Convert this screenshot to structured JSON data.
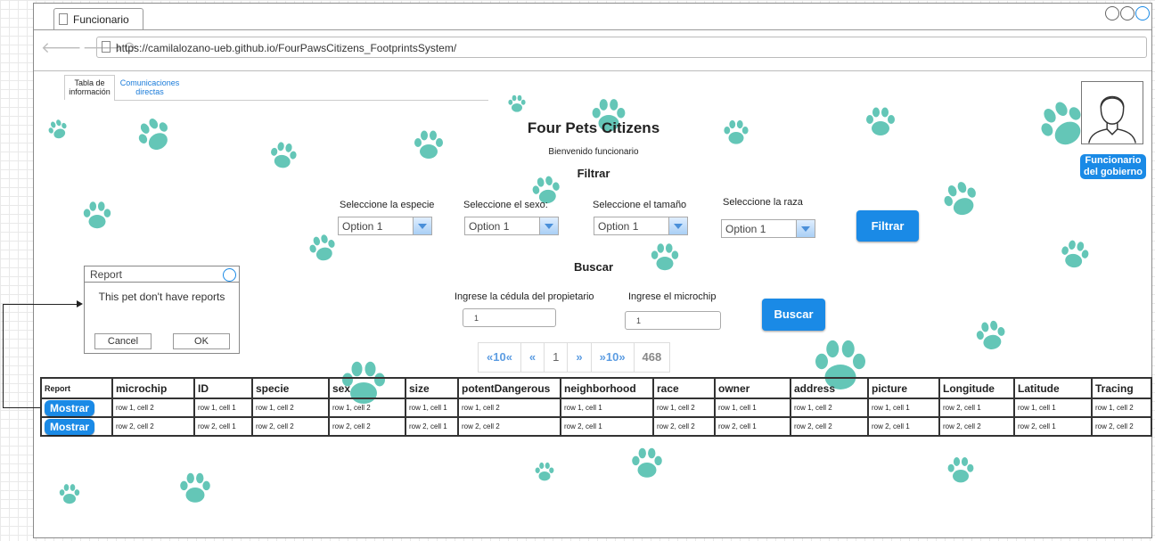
{
  "browser": {
    "tab_title": "Funcionario",
    "url": "https://camilalozano-ueb.github.io/FourPawsCitizens_FootprintsSystem/"
  },
  "nav_tabs": [
    {
      "label": "Tabla de información"
    },
    {
      "label": "Comunicaciones directas"
    }
  ],
  "header": {
    "title": "Four Pets Citizens",
    "welcome": "Bienvenido funcionario",
    "filter_title": "Filtrar",
    "search_title": "Buscar"
  },
  "filters": {
    "species_label": "Seleccione la especie",
    "species_value": "Option 1",
    "sex_label": "Seleccione el sexo:",
    "sex_value": "Option 1",
    "size_label": "Seleccione el tamaño",
    "size_value": "Option 1",
    "race_label": "Seleccione la raza",
    "race_value": "Option 1",
    "filter_button": "Filtrar"
  },
  "search": {
    "owner_label": "Ingrese la cédula del propietario",
    "owner_value": "1",
    "microchip_label": "Ingrese el microchip",
    "microchip_value": "1",
    "search_button": "Buscar"
  },
  "pagination": [
    "«10«",
    "«",
    "1",
    "»",
    "»10»",
    "468"
  ],
  "table": {
    "columns": [
      "Report",
      "microchip",
      "ID",
      "specie",
      "sex",
      "size",
      "potentDangerous",
      "neighborhood",
      "race",
      "owner",
      "address",
      "picture",
      "Longitude",
      "Latitude",
      "Tracing"
    ],
    "rows": [
      {
        "action": "Mostrar",
        "cells": [
          "row 1, cell 2",
          "row 1, cell 1",
          "row 1, cell 2",
          "row 1, cell 2",
          "row 1, cell 1",
          "row 1, cell 2",
          "row 1, cell 1",
          "row 1, cell 2",
          "row 1, cell 1",
          "row 1, cell 2",
          "row 1, cell 1",
          "row 2, cell 1",
          "row 1, cell 1",
          "row 1, cell 2"
        ]
      },
      {
        "action": "Mostrar",
        "cells": [
          "row 2, cell 2",
          "row 2, cell 1",
          "row 2, cell 2",
          "row 2, cell 2",
          "row 2, cell 1",
          "row 2, cell 2",
          "row 2, cell 1",
          "row 2, cell 2",
          "row 2, cell 1",
          "row 2, cell 2",
          "row 2, cell 1",
          "row 2, cell 2",
          "row 2, cell 1",
          "row 2, cell 2"
        ]
      }
    ]
  },
  "dialog": {
    "title": "Report",
    "message": "This pet don't have reports",
    "cancel": "Cancel",
    "ok": "OK"
  },
  "user": {
    "label": "Funcionario del gobierno"
  },
  "colors": {
    "accent": "#1a8ae6",
    "paw": "#5cc4b4"
  }
}
